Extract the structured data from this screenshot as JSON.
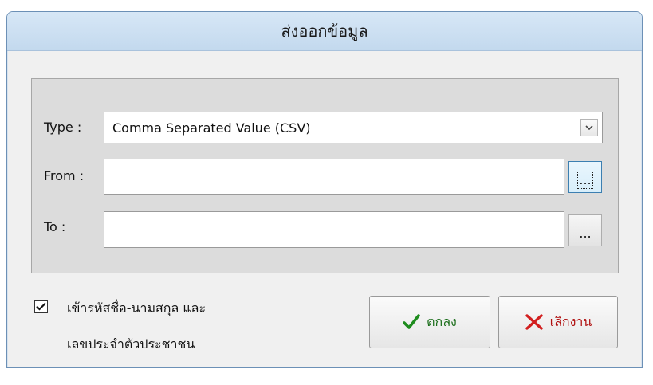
{
  "window": {
    "title": "ส่งออกข้อมูล"
  },
  "form": {
    "type_label": "Type :",
    "type_value": "Comma Separated Value (CSV)",
    "from_label": "From :",
    "from_value": "",
    "from_browse_label": "...",
    "to_label": "To :",
    "to_value": "",
    "to_browse_label": "..."
  },
  "options": {
    "include_ids_line1": "เข้ารหัสชื่อ-นามสกุล และ",
    "include_ids_line2": "เลขประจำตัวประชาชน",
    "include_ids_checked": true
  },
  "buttons": {
    "ok_label": "ตกลง",
    "cancel_label": "เลิกงาน"
  },
  "colors": {
    "ok_icon": "#1e8c1e",
    "cancel_icon": "#d21f1f"
  }
}
